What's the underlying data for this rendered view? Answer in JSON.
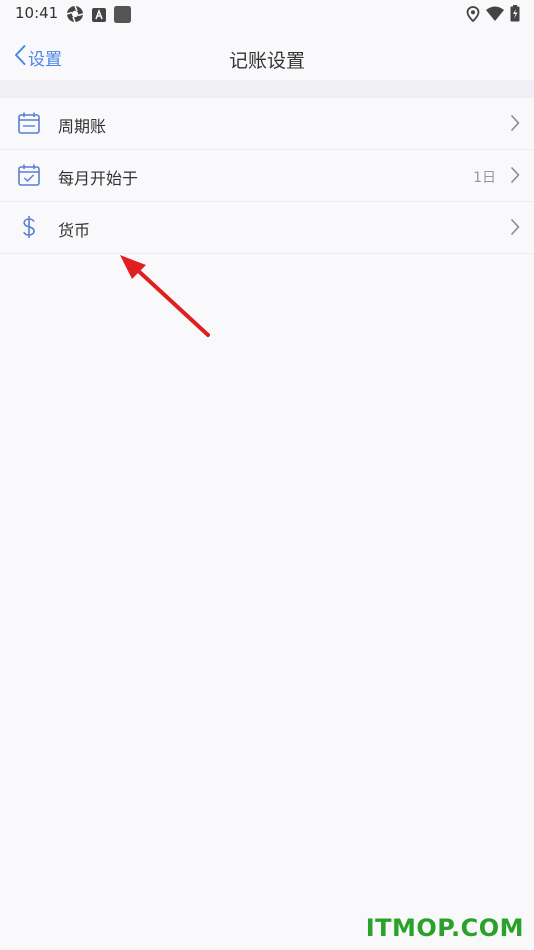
{
  "status_bar": {
    "time": "10:41",
    "left_icons": [
      "aperture-icon",
      "a-badge-icon",
      "square-icon"
    ],
    "right_icons": [
      "location-icon",
      "wifi-icon",
      "battery-icon"
    ]
  },
  "nav": {
    "back_label": "设置",
    "title": "记账设置"
  },
  "settings": {
    "items": [
      {
        "label": "周期账",
        "icon": "calendar-icon",
        "value": ""
      },
      {
        "label": "每月开始于",
        "icon": "calendar-check-icon",
        "value": "1日"
      },
      {
        "label": "货币",
        "icon": "dollar-icon",
        "value": ""
      }
    ]
  },
  "colors": {
    "accent": "#4a86e8",
    "arrow": "#e02020",
    "watermark": "#2aa12a"
  },
  "watermark": "ITMOP.COM"
}
